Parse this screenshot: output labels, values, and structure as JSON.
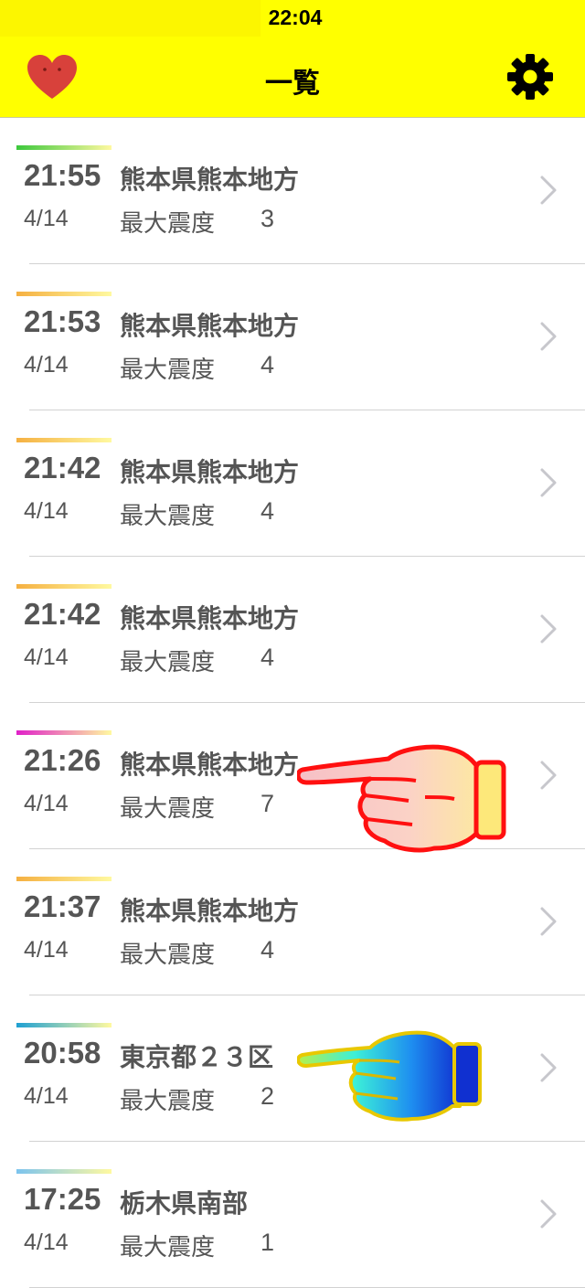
{
  "status_bar": {
    "time": "22:04"
  },
  "nav": {
    "title": "一覧",
    "left_icon": "heart-icon",
    "right_icon": "gear-icon"
  },
  "list": {
    "items": [
      {
        "time": "21:55",
        "region": "熊本県熊本地方",
        "date": "4/14",
        "label": "最大震度",
        "intensity": "3",
        "color": "#3cc83c"
      },
      {
        "time": "21:53",
        "region": "熊本県熊本地方",
        "date": "4/14",
        "label": "最大震度",
        "intensity": "4",
        "color": "#f5b041"
      },
      {
        "time": "21:42",
        "region": "熊本県熊本地方",
        "date": "4/14",
        "label": "最大震度",
        "intensity": "4",
        "color": "#f5b041"
      },
      {
        "time": "21:42",
        "region": "熊本県熊本地方",
        "date": "4/14",
        "label": "最大震度",
        "intensity": "4",
        "color": "#f5b041"
      },
      {
        "time": "21:26",
        "region": "熊本県熊本地方",
        "date": "4/14",
        "label": "最大震度",
        "intensity": "7",
        "color": "#e020c8"
      },
      {
        "time": "21:37",
        "region": "熊本県熊本地方",
        "date": "4/14",
        "label": "最大震度",
        "intensity": "4",
        "color": "#f5b041"
      },
      {
        "time": "20:58",
        "region": "東京都２３区",
        "date": "4/14",
        "label": "最大震度",
        "intensity": "2",
        "color": "#1ea0d2"
      },
      {
        "time": "17:25",
        "region": "栃木県南部",
        "date": "4/14",
        "label": "最大震度",
        "intensity": "1",
        "color": "#7cc4ee"
      }
    ]
  },
  "annotations": {
    "pointer_red": "pointing-hand-red",
    "pointer_blue": "pointing-hand-blue"
  }
}
